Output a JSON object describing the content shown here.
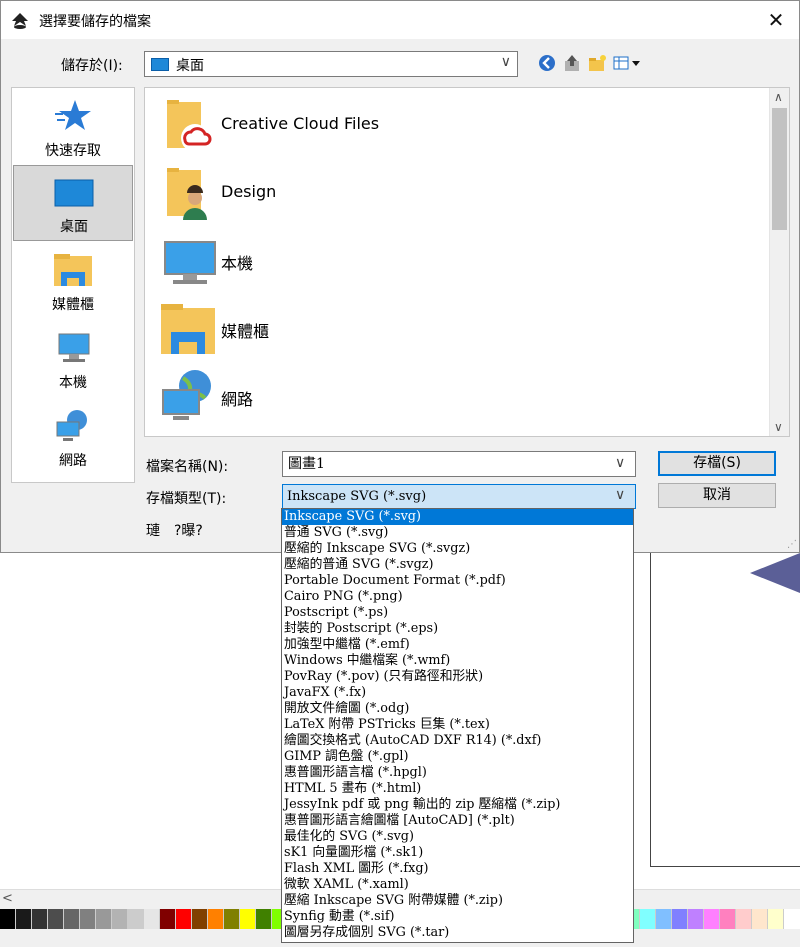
{
  "dialog": {
    "title": "選擇要儲存的檔案",
    "close_glyph": "✕",
    "save_in_label": "儲存於(I):",
    "save_in_value": "桌面",
    "places": [
      "快速存取",
      "桌面",
      "媒體櫃",
      "本機",
      "網路"
    ],
    "files": [
      "Creative Cloud Files",
      "Design",
      "本機",
      "媒體櫃",
      "網路"
    ],
    "filename_label": "檔案名稱(N):",
    "filename_value": "圖畫1",
    "filetype_label": "存檔類型(T):",
    "filetype_value": "Inkscape SVG (*.svg)",
    "extra_label": "璉　?曝?",
    "save_button": "存檔(S)",
    "cancel_button": "取消"
  },
  "filetype_options": [
    "Inkscape SVG (*.svg)",
    "普通 SVG (*.svg)",
    "壓縮的 Inkscape SVG (*.svgz)",
    "壓縮的普通 SVG (*.svgz)",
    "Portable Document Format (*.pdf)",
    "Cairo PNG (*.png)",
    "Postscript (*.ps)",
    "封裝的 Postscript (*.eps)",
    "加強型中繼檔 (*.emf)",
    "Windows 中繼檔案 (*.wmf)",
    "PovRay (*.pov) (只有路徑和形狀)",
    "JavaFX (*.fx)",
    "開放文件繪圖 (*.odg)",
    "LaTeX 附帶 PSTricks 巨集 (*.tex)",
    "繪圖交換格式 (AutoCAD DXF R14) (*.dxf)",
    "GIMP 調色盤 (*.gpl)",
    "惠普圖形語言檔 (*.hpgl)",
    "HTML 5 畫布 (*.html)",
    "JessyInk pdf 或 png 輸出的 zip 壓縮檔 (*.zip)",
    "惠普圖形語言繪圖檔 [AutoCAD] (*.plt)",
    "最佳化的 SVG (*.svg)",
    "sK1 向量圖形檔 (*.sk1)",
    "Flash XML 圖形 (*.fxg)",
    "微軟 XAML (*.xaml)",
    "壓縮 Inkscape SVG 附帶媒體 (*.zip)",
    "Synfig 動畫 (*.sif)",
    "圖層另存成個別 SVG (*.tar)"
  ],
  "selected_option_index": 0,
  "palette_colors": [
    "#000000",
    "#1a1a1a",
    "#333333",
    "#4d4d4d",
    "#666666",
    "#808080",
    "#999999",
    "#b3b3b3",
    "#cccccc",
    "#e6e6e6",
    "#800000",
    "#ff0000",
    "#804000",
    "#ff8000",
    "#808000",
    "#ffff00",
    "#408000",
    "#80ff00",
    "#008000",
    "#00ff00",
    "#008040",
    "#00ff80",
    "#008080",
    "#00ffff",
    "#004080",
    "#0080ff",
    "#000080",
    "#0000ff",
    "#400080",
    "#8000ff",
    "#800080",
    "#ff00ff",
    "#800040",
    "#ff0080",
    "#ff8080",
    "#ffbf80",
    "#ffff80",
    "#bfff80",
    "#80ff80",
    "#80ffbf",
    "#80ffff",
    "#80bfff",
    "#8080ff",
    "#bf80ff",
    "#ff80ff",
    "#ff80bf",
    "#ffcccc",
    "#ffe6cc",
    "#ffffcc"
  ],
  "colors": {
    "accent": "#0078d7",
    "dialog_bg": "#f0f0f0",
    "selection": "#0078d7"
  }
}
